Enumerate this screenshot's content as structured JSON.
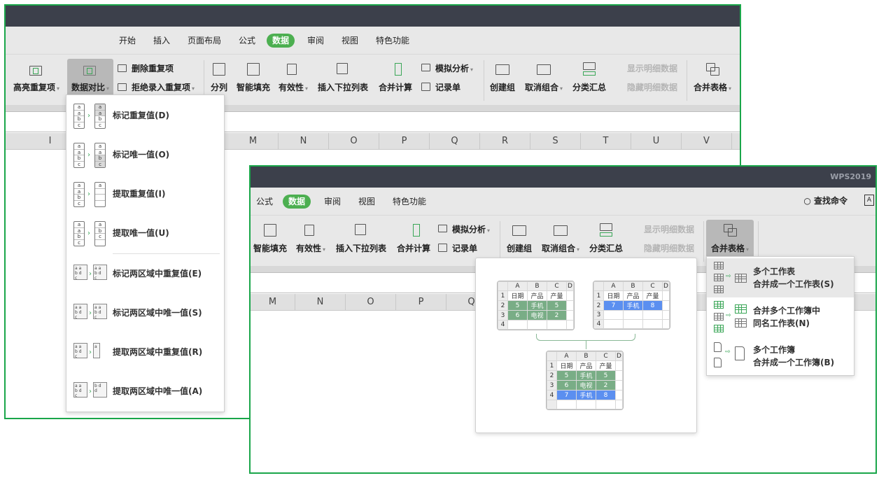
{
  "app": {
    "brand": "WPS2019"
  },
  "window_back": {
    "tabs": [
      {
        "label": "开始",
        "active": false
      },
      {
        "label": "插入",
        "active": false
      },
      {
        "label": "页面布局",
        "active": false
      },
      {
        "label": "公式",
        "active": false
      },
      {
        "label": "数据",
        "active": true
      },
      {
        "label": "审阅",
        "active": false
      },
      {
        "label": "视图",
        "active": false
      },
      {
        "label": "特色功能",
        "active": false
      }
    ],
    "ribbon": {
      "highlight_dup": "高亮重复项",
      "data_compare": "数据对比",
      "delete_dup": "删除重复项",
      "reject_dup": "拒绝录入重复项",
      "split_col": "分列",
      "smart_fill": "智能填充",
      "validity": "有效性",
      "insert_dropdown": "插入下拉列表",
      "consolidate": "合并计算",
      "what_if": "模拟分析",
      "record_form": "记录单",
      "create_group": "创建组",
      "ungroup": "取消组合",
      "subtotal": "分类汇总",
      "show_detail": "显示明细数据",
      "hide_detail": "隐藏明细数据",
      "merge_tables": "合并表格"
    },
    "columns": [
      "I",
      "M",
      "N",
      "O",
      "P",
      "Q",
      "R",
      "S",
      "T",
      "U",
      "V"
    ],
    "compare_menu": [
      {
        "label": "标记重复值(D)",
        "shortcut": "D"
      },
      {
        "label": "标记唯一值(O)",
        "shortcut": "O"
      },
      {
        "label": "提取重复值(I)",
        "shortcut": "I"
      },
      {
        "label": "提取唯一值(U)",
        "shortcut": "U"
      },
      {
        "label": "标记两区域中重复值(E)",
        "shortcut": "E"
      },
      {
        "label": "标记两区域中唯一值(S)",
        "shortcut": "S"
      },
      {
        "label": "提取两区域中重复值(R)",
        "shortcut": "R"
      },
      {
        "label": "提取两区域中唯一值(A)",
        "shortcut": "A"
      }
    ]
  },
  "window_front": {
    "tabs": [
      {
        "label": "公式",
        "active": false
      },
      {
        "label": "数据",
        "active": true
      },
      {
        "label": "审阅",
        "active": false
      },
      {
        "label": "视图",
        "active": false
      },
      {
        "label": "特色功能",
        "active": false
      }
    ],
    "search_label": "查找命令",
    "ribbon": {
      "smart_fill": "智能填充",
      "validity": "有效性",
      "insert_dropdown": "插入下拉列表",
      "consolidate": "合并计算",
      "what_if": "模拟分析",
      "record_form": "记录单",
      "create_group": "创建组",
      "ungroup": "取消组合",
      "subtotal": "分类汇总",
      "show_detail": "显示明细数据",
      "hide_detail": "隐藏明细数据",
      "merge_tables": "合并表格"
    },
    "columns": [
      "M",
      "N",
      "O",
      "P",
      "Q"
    ],
    "merge_menu": [
      {
        "line1": "多个工作表",
        "line2": "合并成一个工作表(S)",
        "highlighted": true
      },
      {
        "line1": "合并多个工作簿中",
        "line2": "同名工作表(N)",
        "highlighted": false
      },
      {
        "line1": "多个工作簿",
        "line2": "合并成一个工作簿(B)",
        "highlighted": false
      }
    ],
    "preview": {
      "col_headers": [
        "",
        "A",
        "B",
        "C",
        "D"
      ],
      "sheet1": [
        [
          "1",
          "日期",
          "产品",
          "产量",
          ""
        ],
        [
          "2",
          "5",
          "手机",
          "5",
          ""
        ],
        [
          "3",
          "6",
          "电视",
          "2",
          ""
        ],
        [
          "4",
          "",
          "",
          "",
          ""
        ]
      ],
      "sheet2": [
        [
          "1",
          "日期",
          "产品",
          "产量",
          ""
        ],
        [
          "2",
          "7",
          "手机",
          "8",
          ""
        ],
        [
          "3",
          "",
          "",
          "",
          ""
        ],
        [
          "4",
          "",
          "",
          "",
          ""
        ]
      ],
      "merged": [
        [
          "1",
          "日期",
          "产品",
          "产量",
          ""
        ],
        [
          "2",
          "5",
          "手机",
          "5",
          ""
        ],
        [
          "3",
          "6",
          "电视",
          "2",
          ""
        ],
        [
          "4",
          "7",
          "手机",
          "8",
          ""
        ],
        [
          "",
          "",
          "",
          "",
          ""
        ]
      ],
      "colors": {
        "green": "#79ad86",
        "blue": "#5b8ff0"
      }
    }
  },
  "colors": {
    "accent": "#4caf50",
    "frame": "#1aa64a",
    "titlebar": "#3c404b"
  }
}
